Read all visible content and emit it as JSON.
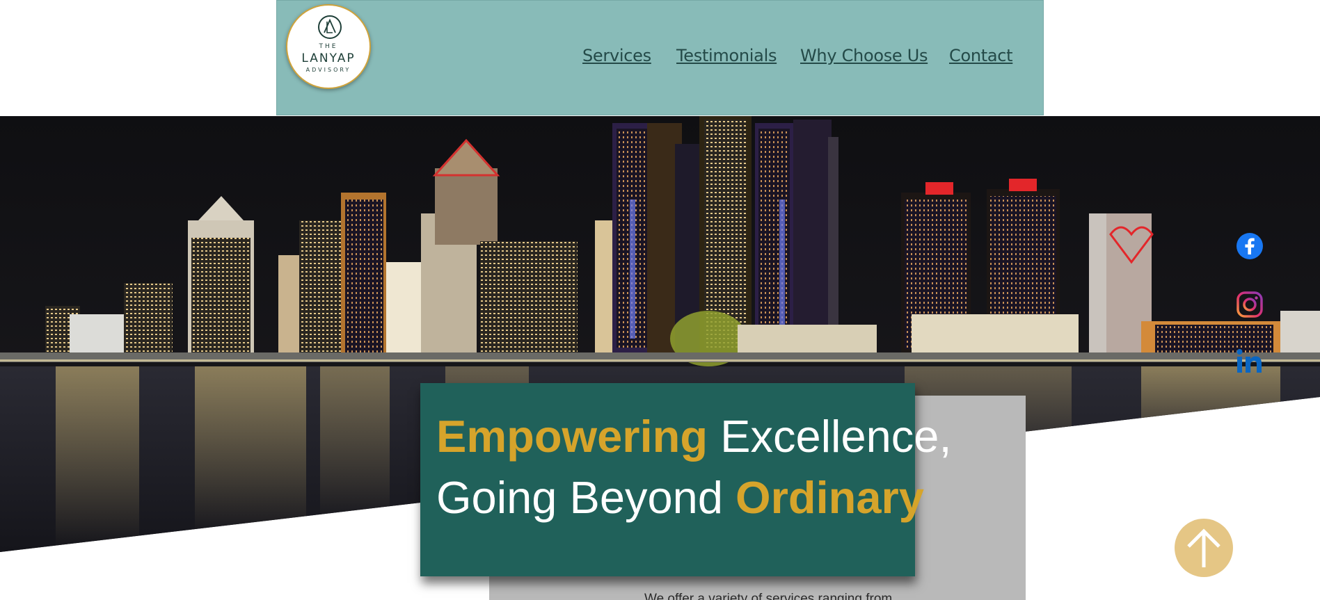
{
  "logo": {
    "line1": "THE",
    "line2": "LANYAP",
    "line3": "ADVISORY"
  },
  "nav": {
    "items": [
      {
        "label": "Services"
      },
      {
        "label": "Testimonials"
      },
      {
        "label": "Why Choose Us"
      },
      {
        "label": "Contact"
      }
    ]
  },
  "hero": {
    "headline_line1_highlight": "Empowering",
    "headline_line1_rest": " Excellence,",
    "headline_line2_start": "Going Beyond ",
    "headline_line2_highlight": "Ordinary"
  },
  "services_intro": {
    "text": "We offer a variety of services ranging from"
  },
  "social": [
    "facebook-icon",
    "instagram-icon",
    "linkedin-icon"
  ],
  "colors": {
    "header_bg": "#88bbb8",
    "card_bg": "#20615a",
    "accent_gold": "#d6a42b",
    "nav_text": "#244a48",
    "back_to_top": "#e5c685"
  }
}
